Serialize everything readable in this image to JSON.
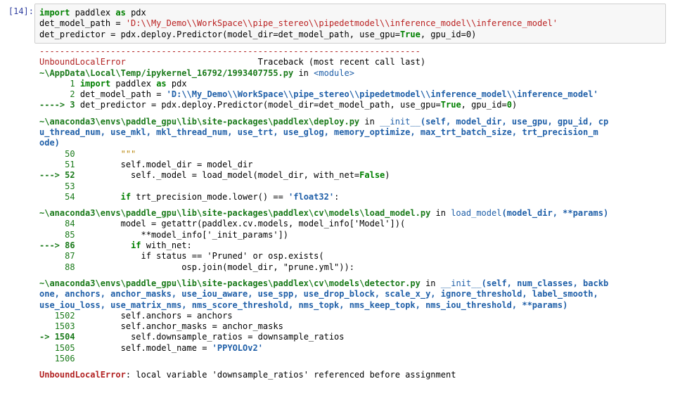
{
  "prompt": "[14]:",
  "input": {
    "line1": [
      "import",
      " paddlex ",
      "as",
      " pdx"
    ],
    "line2": [
      "det_model_path = ",
      "'D:\\\\My_Demo\\\\WorkSpace\\\\pipe_stereo\\\\pipedetmodel\\\\inference_model\\\\inference_model'"
    ],
    "line3": [
      "det_predictor = pdx.deploy.Predictor(model_dir=det_model_path, use_gpu=",
      "True",
      ", gpu_id=",
      "0",
      ")"
    ]
  },
  "traceback": {
    "dashes": "---------------------------------------------------------------------------",
    "error_name": "UnboundLocalError",
    "header_right": "                          Traceback (most recent call last)",
    "frames": [
      {
        "path": "~\\AppData\\Local\\Temp/ipykernel_16792/1993407755.py",
        "in": " in ",
        "func": "<module>",
        "sig": "",
        "lines": [
          {
            "arrow": "      ",
            "num": "1",
            "code": " import paddlex as pdx"
          },
          {
            "arrow": "      ",
            "num": "2",
            "code": " det_model_path = 'D:\\\\My_Demo\\\\WorkSpace\\\\pipe_stereo\\\\pipedetmodel\\\\inference_model\\\\inference_model'"
          },
          {
            "arrow": "----> ",
            "num": "3",
            "code": " det_predictor = pdx.deploy.Predictor(model_dir=det_model_path, use_gpu=True, gpu_id=0)"
          }
        ]
      },
      {
        "path": "~\\anaconda3\\envs\\paddle_gpu\\lib\\site-packages\\paddlex\\deploy.py",
        "in": " in ",
        "func": "__init__",
        "sig": "(self, model_dir, use_gpu, gpu_id, cp",
        "sig_cont": [
          "u_thread_num, use_mkl, mkl_thread_num, use_trt, use_glog, memory_optimize, max_trt_batch_size, trt_precision_m",
          "ode)"
        ],
        "lines": [
          {
            "arrow": "     ",
            "num": "50",
            "code": "         \"\"\""
          },
          {
            "arrow": "     ",
            "num": "51",
            "code": "         self.model_dir = model_dir"
          },
          {
            "arrow": "---> ",
            "num": "52",
            "code": "           self._model = load_model(model_dir, with_net=False)"
          },
          {
            "arrow": "     ",
            "num": "53",
            "code": ""
          },
          {
            "arrow": "     ",
            "num": "54",
            "code": "         if trt_precision_mode.lower() == 'float32':"
          }
        ]
      },
      {
        "path": "~\\anaconda3\\envs\\paddle_gpu\\lib\\site-packages\\paddlex\\cv\\models\\load_model.py",
        "in": " in ",
        "func": "load_model",
        "sig": "(model_dir, **params)",
        "lines": [
          {
            "arrow": "     ",
            "num": "84",
            "code": "         model = getattr(paddlex.cv.models, model_info['Model'])("
          },
          {
            "arrow": "     ",
            "num": "85",
            "code": "             **model_info['_init_params'])"
          },
          {
            "arrow": "---> ",
            "num": "86",
            "code": "           if with_net:"
          },
          {
            "arrow": "     ",
            "num": "87",
            "code": "             if status == 'Pruned' or osp.exists("
          },
          {
            "arrow": "     ",
            "num": "88",
            "code": "                     osp.join(model_dir, \"prune.yml\")):"
          }
        ]
      },
      {
        "path": "~\\anaconda3\\envs\\paddle_gpu\\lib\\site-packages\\paddlex\\cv\\models\\detector.py",
        "in": " in ",
        "func": "__init__",
        "sig": "(self, num_classes, backb",
        "sig_cont": [
          "one, anchors, anchor_masks, use_iou_aware, use_spp, use_drop_block, scale_x_y, ignore_threshold, label_smooth,",
          "use_iou_loss, use_matrix_nms, nms_score_threshold, nms_topk, nms_keep_topk, nms_iou_threshold, **params)"
        ],
        "lines": [
          {
            "arrow": "   ",
            "num": "1502",
            "code": "         self.anchors = anchors"
          },
          {
            "arrow": "   ",
            "num": "1503",
            "code": "         self.anchor_masks = anchor_masks"
          },
          {
            "arrow": "-> ",
            "num": "1504",
            "code": "           self.downsample_ratios = downsample_ratios"
          },
          {
            "arrow": "   ",
            "num": "1505",
            "code": "         self.model_name = 'PPYOLOv2'"
          },
          {
            "arrow": "   ",
            "num": "1506",
            "code": ""
          }
        ]
      }
    ],
    "final_error": "UnboundLocalError",
    "final_message": ": local variable 'downsample_ratios' referenced before assignment"
  }
}
